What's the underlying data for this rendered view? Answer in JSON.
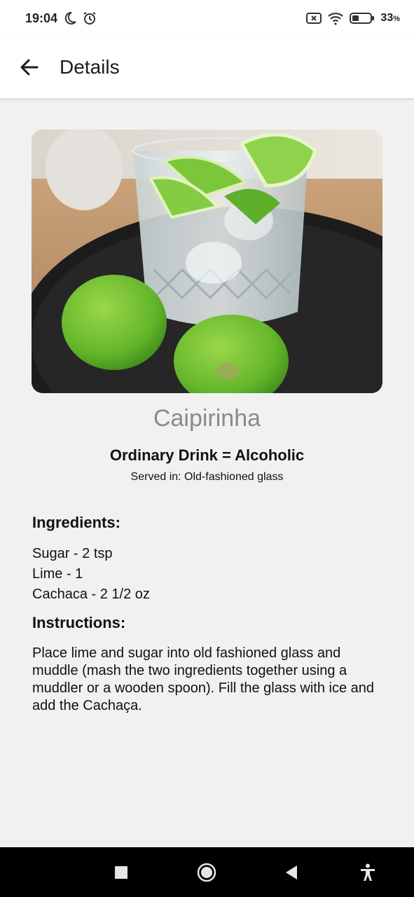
{
  "status_bar": {
    "time": "19:04",
    "battery_percent": "33",
    "battery_unit": "%",
    "icons": [
      "moon-icon",
      "alarm-icon",
      "sim-off-icon",
      "wifi-icon",
      "battery-icon"
    ]
  },
  "app_bar": {
    "title": "Details",
    "back_icon": "arrow-back-icon"
  },
  "drink": {
    "name": "Caipirinha",
    "category_line": "Ordinary Drink = Alcoholic",
    "glass_line": "Served in: Old-fashioned glass",
    "image_description": "caipirinha-photo"
  },
  "ingredients": {
    "heading": "Ingredients:",
    "items": [
      "Sugar - 2 tsp",
      "Lime - 1",
      "Cachaca - 2 1/2 oz"
    ]
  },
  "instructions": {
    "heading": "Instructions:",
    "text": "Place lime and sugar into old fashioned glass and muddle (mash the two ingredients together using a muddler or a wooden spoon). Fill the glass with ice and add the Cachaça."
  },
  "nav_bar": {
    "icons": [
      "recents-square-icon",
      "home-circle-icon",
      "back-triangle-icon",
      "accessibility-icon"
    ]
  },
  "colors": {
    "background": "#f1f1f1",
    "surface": "#ffffff",
    "drink_name": "#8a8a8a",
    "nav_bar": "#000000"
  }
}
